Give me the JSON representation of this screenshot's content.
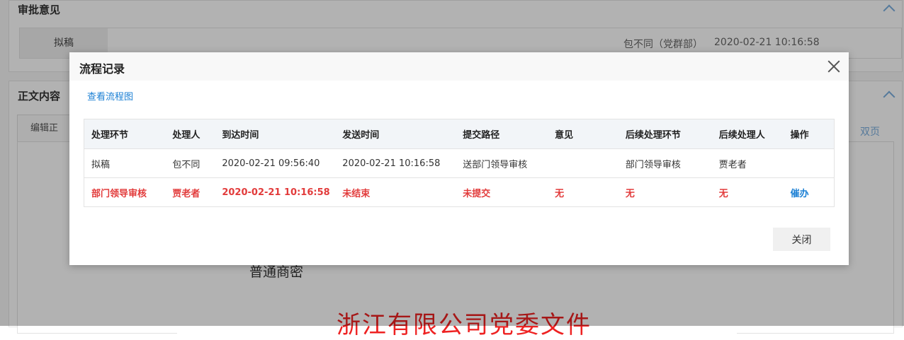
{
  "background": {
    "approval_section_title": "审批意见",
    "approval_row": {
      "label": "拟稿",
      "person": "包不同（党群部）",
      "time": "2020-02-21 10:16:58"
    },
    "content_section_title": "正文内容",
    "toolbar_edit_label": "编辑正",
    "dual_page_label": "双页",
    "doc_secret_level": "普通商密",
    "doc_title": "浙江有限公司党委文件"
  },
  "modal": {
    "title": "流程记录",
    "flow_chart_link": "查看流程图",
    "close_button": "关闭",
    "columns": [
      "处理环节",
      "处理人",
      "到达时间",
      "发送时间",
      "提交路径",
      "意见",
      "后续处理环节",
      "后续处理人",
      "操作"
    ],
    "rows": [
      {
        "step": "拟稿",
        "handler": "包不同",
        "arrive": "2020-02-21 09:56:40",
        "send": "2020-02-21 10:16:58",
        "path": "送部门领导审核",
        "opinion": "",
        "next_step": "部门领导审核",
        "next_handler": "贾老者",
        "action": ""
      },
      {
        "step": "部门领导审核",
        "handler": "贾老者",
        "arrive": "2020-02-21 10:16:58",
        "send": "未结束",
        "path": "未提交",
        "opinion": "无",
        "next_step": "无",
        "next_handler": "无",
        "action": "催办"
      }
    ]
  },
  "colors": {
    "accent": "#1a7fd4",
    "active_row": "#e23b3b"
  }
}
